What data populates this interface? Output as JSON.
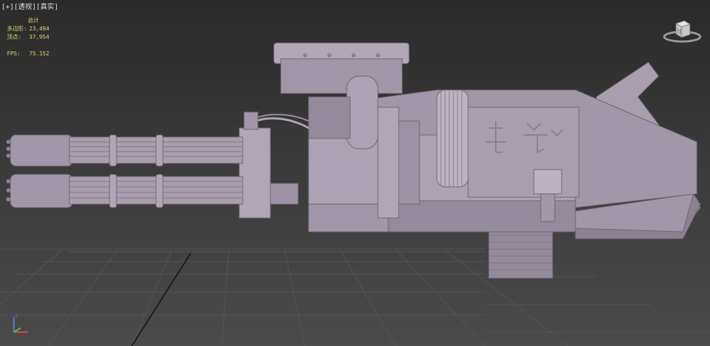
{
  "viewport": {
    "label_plus": "[+]",
    "label_view": "[透视]",
    "label_shading": "[真实]"
  },
  "stats": {
    "total_label": "总计",
    "polys_label": "多边形:",
    "polys_value": "23,494",
    "verts_label": "顶点:",
    "verts_value": "37,954",
    "fps_label": "FPS:",
    "fps_value": "75.152"
  },
  "colors": {
    "model": "#a297a8",
    "model_dark": "#7f7585",
    "model_light": "#bdb2c2",
    "grid": "#5a5a5a",
    "stats_text": "#e8d86a"
  },
  "icons": {
    "viewcube": "viewcube-icon",
    "axis": "axis-tripod-icon"
  }
}
